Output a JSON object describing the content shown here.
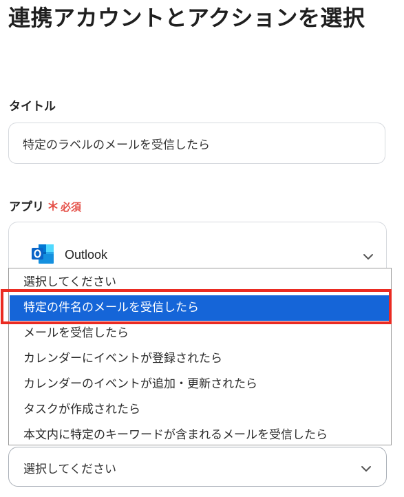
{
  "page": {
    "title": "連携アカウントとアクションを選択"
  },
  "form": {
    "title_label": "タイトル",
    "title_value": "特定のラベルのメールを受信したら",
    "app_label": "アプリ",
    "required_mark": "＊",
    "required_text": "必須",
    "selected_app": {
      "name": "Outlook",
      "icon": "outlook-icon",
      "icon_color": "#0a64c8"
    }
  },
  "dropdown": {
    "options": [
      "選択してください",
      "特定の件名のメールを受信したら",
      "メールを受信したら",
      "カレンダーにイベントが登録されたら",
      "カレンダーのイベントが追加・更新されたら",
      "タスクが作成されたら",
      "本文内に特定のキーワードが含まれるメールを受信したら"
    ],
    "selected_index": 1,
    "selected_color": "#1565d8",
    "highlight_color": "#ea2b22"
  },
  "bottom_select": {
    "value": "選択してください",
    "icon": "chevron-down-icon"
  }
}
